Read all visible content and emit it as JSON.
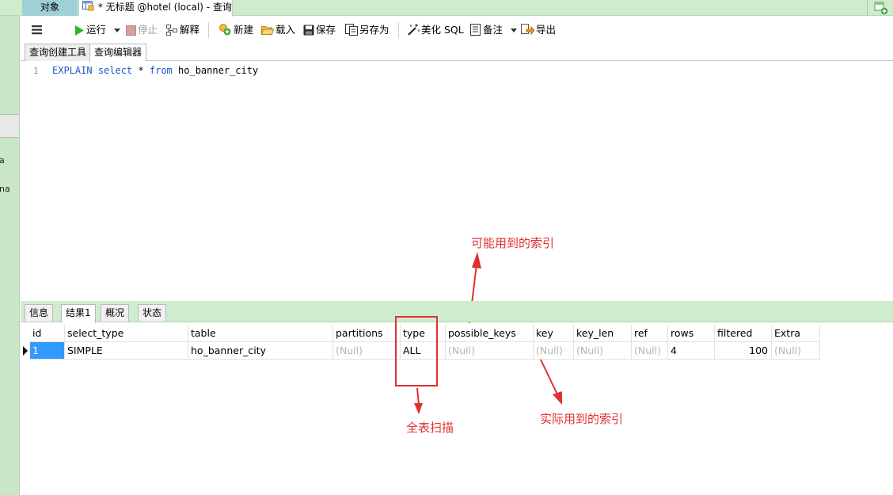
{
  "tabs": {
    "objects": "对象",
    "query_tab": "* 无标题 @hotel (local) - 查询"
  },
  "left_fragments": [
    "a",
    "na"
  ],
  "toolbar": {
    "run": "运行",
    "stop": "停止",
    "explain": "解释",
    "new": "新建",
    "load": "载入",
    "save": "保存",
    "save_as": "另存为",
    "beautify": "美化 SQL",
    "comment": "备注",
    "export": "导出"
  },
  "subtabs": {
    "builder": "查询创建工具",
    "editor": "查询编辑器"
  },
  "editor": {
    "line_number": "1",
    "kw1": "EXPLAIN",
    "kw2": "select",
    "star": "*",
    "kw3": "from",
    "table": "ho_banner_city"
  },
  "result_tabs": [
    "信息",
    "结果1",
    "概况",
    "状态"
  ],
  "grid": {
    "columns": [
      "id",
      "select_type",
      "table",
      "partitions",
      "type",
      "possible_keys",
      "key",
      "key_len",
      "ref",
      "rows",
      "filtered",
      "Extra"
    ],
    "rows": [
      [
        "1",
        "SIMPLE",
        "ho_banner_city",
        "(Null)",
        "ALL",
        "(Null)",
        "(Null)",
        "(Null)",
        "(Null)",
        "4",
        "100",
        "(Null)"
      ]
    ]
  },
  "annotations": {
    "possible": "可能用到的索引",
    "full_scan": "全表扫描",
    "actual": "实际用到的索引"
  },
  "colors": {
    "accent_green": "#cfeccf",
    "annotation_red": "#e03030",
    "keyword_blue": "#1f57c5",
    "selection_blue": "#3399ff"
  }
}
